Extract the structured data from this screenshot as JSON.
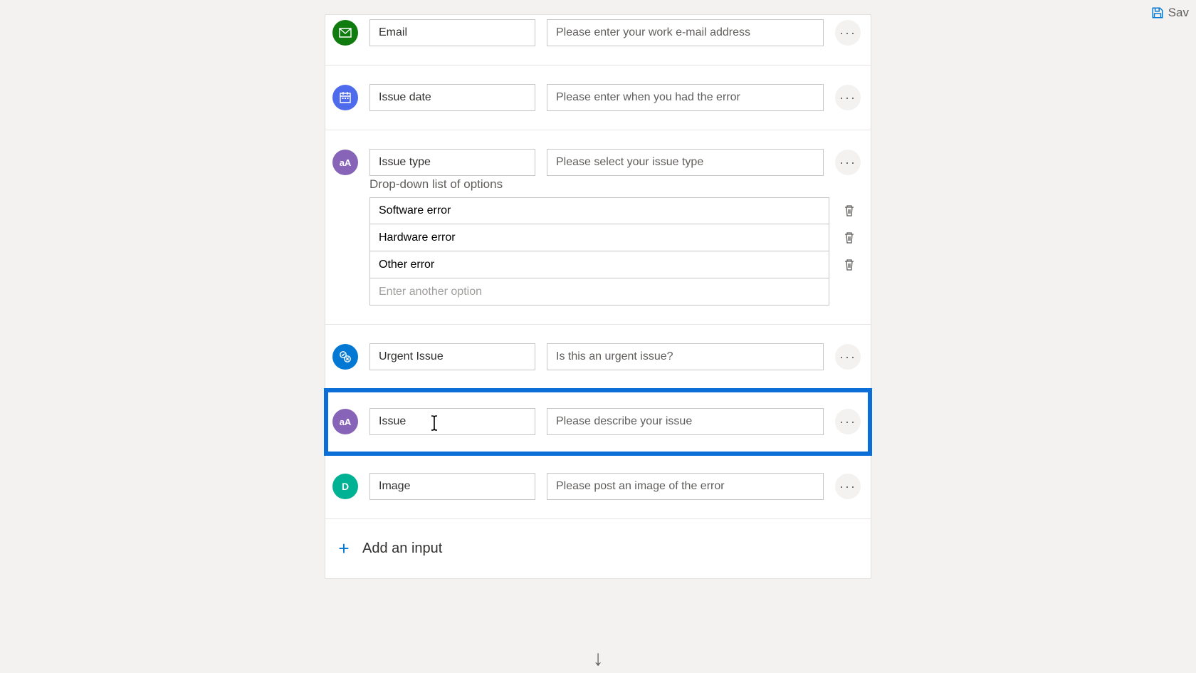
{
  "toolbar": {
    "save_label": "Sav"
  },
  "fields": [
    {
      "id": "email",
      "name": "Email",
      "placeholder": "Please enter your work e-mail address",
      "badge_text": ""
    },
    {
      "id": "date",
      "name": "Issue date",
      "placeholder": "Please enter when you had the error",
      "badge_text": ""
    },
    {
      "id": "type",
      "name": "Issue type",
      "placeholder": "Please select your issue type",
      "badge_text": "aA"
    },
    {
      "id": "urgent",
      "name": "Urgent Issue",
      "placeholder": "Is this an urgent issue?",
      "badge_text": ""
    },
    {
      "id": "issue",
      "name": "Issue",
      "placeholder": "Please describe your issue",
      "badge_text": "aA"
    },
    {
      "id": "image",
      "name": "Image",
      "placeholder": "Please post an image of the error",
      "badge_text": "D"
    }
  ],
  "dropdown": {
    "title": "Drop-down list of options",
    "options": [
      "Software error",
      "Hardware error",
      "Other error"
    ],
    "new_option_placeholder": "Enter another option"
  },
  "add_input_label": "Add an input",
  "colors": {
    "email": "#107c10",
    "date": "#4f6bed",
    "text": "#8764b8",
    "yesno": "#0078d4",
    "file": "#00b294",
    "highlight": "#0b6fd7"
  }
}
